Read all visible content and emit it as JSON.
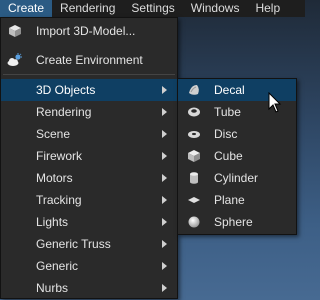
{
  "menubar": {
    "items": [
      "Create",
      "Rendering",
      "Settings",
      "Windows",
      "Help"
    ]
  },
  "create_menu": {
    "top_items": [
      {
        "label": "Import 3D-Model...",
        "icon": "cube-import-icon"
      },
      {
        "label": "Create Environment",
        "icon": "cloud-sun-icon"
      }
    ],
    "submenus": [
      {
        "label": "3D Objects",
        "highlighted": true
      },
      {
        "label": "Rendering"
      },
      {
        "label": "Scene"
      },
      {
        "label": "Firework"
      },
      {
        "label": "Motors"
      },
      {
        "label": "Tracking"
      },
      {
        "label": "Lights"
      },
      {
        "label": "Generic Truss"
      },
      {
        "label": "Generic"
      },
      {
        "label": "Nurbs"
      }
    ]
  },
  "objects_submenu": {
    "items": [
      {
        "label": "Decal",
        "icon": "decal-icon",
        "highlighted": true
      },
      {
        "label": "Tube",
        "icon": "tube-icon"
      },
      {
        "label": "Disc",
        "icon": "disc-icon"
      },
      {
        "label": "Cube",
        "icon": "cube-icon"
      },
      {
        "label": "Cylinder",
        "icon": "cylinder-icon"
      },
      {
        "label": "Plane",
        "icon": "plane-icon"
      },
      {
        "label": "Sphere",
        "icon": "sphere-icon"
      }
    ]
  },
  "colors": {
    "menubar_bg": "#1e1e1e",
    "menu_bg": "#2a2a2a",
    "highlight": "#0f3f63",
    "active_menu": "#2b5b84"
  }
}
